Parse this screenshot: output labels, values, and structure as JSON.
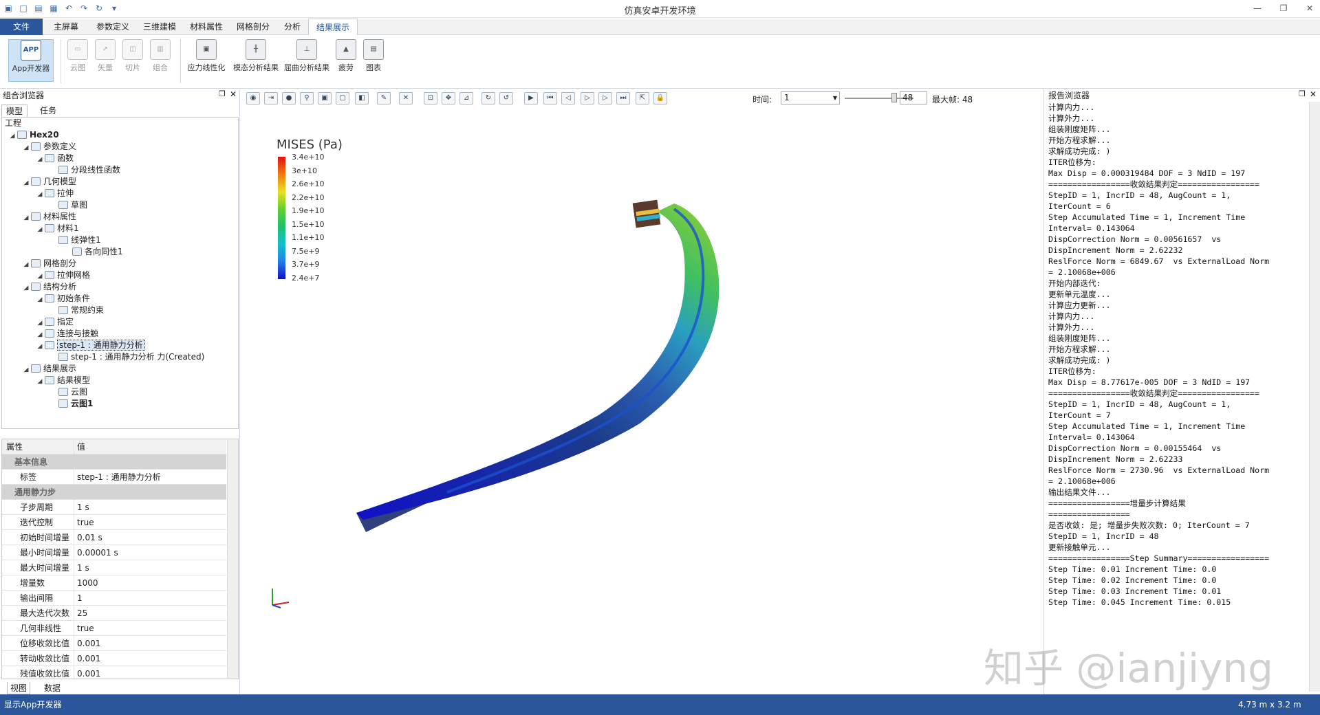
{
  "app": {
    "title": "仿真安卓开发环境"
  },
  "quick_access": [
    "app-icon",
    "new-icon",
    "open-icon",
    "save-icon",
    "undo-icon",
    "redo-icon",
    "refresh-icon",
    "more-icon"
  ],
  "menubar": {
    "items": [
      "文件",
      "主屏幕",
      "参数定义",
      "三维建模",
      "材料属性",
      "网格剖分",
      "分析",
      "结果展示"
    ],
    "active": "结果展示"
  },
  "ribbon": {
    "app": "App开发器",
    "buttons": [
      "云图",
      "矢量",
      "切片",
      "组合",
      "应力线性化",
      "模态分析结果",
      "屈曲分析结果",
      "疲劳",
      "图表"
    ]
  },
  "left_panel": {
    "title": "组合浏览器",
    "tabs": [
      "模型",
      "任务"
    ],
    "tree_root": "工程",
    "tree": [
      {
        "label": "Hex20",
        "level": 0,
        "bold": true,
        "icon": "model-icon"
      },
      {
        "label": "参数定义",
        "level": 1,
        "icon": "param-icon"
      },
      {
        "label": "函数",
        "level": 2,
        "icon": "function-icon"
      },
      {
        "label": "分段线性函数",
        "level": 3,
        "icon": "function-icon"
      },
      {
        "label": "几何模型",
        "level": 1,
        "icon": "geometry-icon"
      },
      {
        "label": "拉伸",
        "level": 2,
        "icon": "extrude-icon"
      },
      {
        "label": "草图",
        "level": 3,
        "icon": "sketch-icon"
      },
      {
        "label": "材料属性",
        "level": 1,
        "icon": "material-icon"
      },
      {
        "label": "材料1",
        "level": 2,
        "icon": "material-icon"
      },
      {
        "label": "线弹性1",
        "level": 3,
        "icon": "material-icon"
      },
      {
        "label": "各向同性1",
        "level": 4,
        "icon": "material-icon"
      },
      {
        "label": "网格剖分",
        "level": 1,
        "icon": "mesh-icon"
      },
      {
        "label": "拉伸网格",
        "level": 2,
        "icon": "mesh-icon"
      },
      {
        "label": "结构分析",
        "level": 1,
        "icon": "analysis-icon"
      },
      {
        "label": "初始条件",
        "level": 2,
        "icon": "condition-icon"
      },
      {
        "label": "常规约束",
        "level": 3,
        "icon": "constraint-icon"
      },
      {
        "label": "指定",
        "level": 2,
        "icon": "assign-icon"
      },
      {
        "label": "连接与接触",
        "level": 2,
        "icon": "contact-icon"
      },
      {
        "label": "step-1 : 通用静力分析",
        "level": 2,
        "icon": "step-icon",
        "selected": true
      },
      {
        "label": "step-1 : 通用静力分析 力(Created)",
        "level": 3,
        "icon": "force-icon"
      },
      {
        "label": "结果展示",
        "level": 1,
        "icon": "result-icon"
      },
      {
        "label": "结果模型",
        "level": 2,
        "icon": "result-icon"
      },
      {
        "label": "云图",
        "level": 3,
        "icon": "contour-icon"
      },
      {
        "label": "云图1",
        "level": 3,
        "bold": true,
        "icon": "contour-icon"
      }
    ],
    "props_header": {
      "key": "属性",
      "value": "值"
    },
    "props": [
      {
        "group": "基本信息"
      },
      {
        "k": "标签",
        "v": "step-1 : 通用静力分析"
      },
      {
        "group": "通用静力步"
      },
      {
        "k": "子步周期",
        "v": "1 s"
      },
      {
        "k": "迭代控制",
        "v": "true"
      },
      {
        "k": "初始时间增量",
        "v": "0.01 s"
      },
      {
        "k": "最小时间增量",
        "v": "0.00001 s"
      },
      {
        "k": "最大时间增量",
        "v": "1 s"
      },
      {
        "k": "增量数",
        "v": "1000"
      },
      {
        "k": "输出间隔",
        "v": "1"
      },
      {
        "k": "最大迭代次数",
        "v": "25"
      },
      {
        "k": "几何非线性",
        "v": "true"
      },
      {
        "k": "位移收敛比值",
        "v": "0.001"
      },
      {
        "k": "转动收敛比值",
        "v": "0.001"
      },
      {
        "k": "残值收敛比值",
        "v": "0.001"
      }
    ],
    "bottom_tabs": [
      "视图",
      "数据"
    ]
  },
  "viewport": {
    "toolbar": {
      "time_label": "时间:",
      "time_value": "1",
      "frame_value": "48",
      "max_frame": "最大帧: 48"
    },
    "legend": {
      "title": "MISES (Pa)",
      "ticks": [
        "3.4e+10",
        "3e+10",
        "2.6e+10",
        "2.2e+10",
        "1.9e+10",
        "1.5e+10",
        "1.1e+10",
        "7.5e+9",
        "3.7e+9",
        "2.4e+7"
      ]
    }
  },
  "report": {
    "title": "报告浏览器",
    "lines": [
      "计算内力...",
      "计算外力...",
      "组装刚度矩阵...",
      "开始方程求解...",
      "求解成功完成: )",
      "ITER位移为:",
      "Max Disp = 0.000319484 DOF = 3 NdID = 197",
      "=================收敛结果判定=================",
      "StepID = 1, IncrID = 48, AugCount = 1,",
      "IterCount = 6",
      "Step Accumulated Time = 1, Increment Time",
      "Interval= 0.143064",
      "DispCorrection Norm = 0.00561657  vs",
      "DispIncrement Norm = 2.62232",
      "ReslForce Norm = 6849.67  vs ExternalLoad Norm",
      "= 2.10068e+006",
      "",
      "开始内部迭代:",
      "更新单元温度...",
      "计算应力更新...",
      "计算内力...",
      "计算外力...",
      "组装刚度矩阵...",
      "开始方程求解...",
      "求解成功完成: )",
      "ITER位移为:",
      "Max Disp = 8.77617e-005 DOF = 3 NdID = 197",
      "=================收敛结果判定=================",
      "StepID = 1, IncrID = 48, AugCount = 1,",
      "IterCount = 7",
      "Step Accumulated Time = 1, Increment Time",
      "Interval= 0.143064",
      "DispCorrection Norm = 0.00155464  vs",
      "DispIncrement Norm = 2.62233",
      "ReslForce Norm = 2730.96  vs ExternalLoad Norm",
      "= 2.10068e+006",
      "",
      "输出结果文件...",
      "",
      "=================增量步计算结果",
      "=================",
      "是否收敛: 是; 增量步失败次数: 0; IterCount = 7",
      "StepID = 1, IncrID = 48",
      "",
      "更新接触单元...",
      "",
      "=================Step Summary=================",
      "Step Time: 0.01 Increment Time: 0.0",
      "Step Time: 0.02 Increment Time: 0.0",
      "Step Time: 0.03 Increment Time: 0.01",
      "Step Time: 0.045 Increment Time: 0.015"
    ]
  },
  "status": {
    "left": "显示App开发器",
    "right": "4.73 m x 3.2 m"
  },
  "watermark": "知乎 @ianjiyng"
}
